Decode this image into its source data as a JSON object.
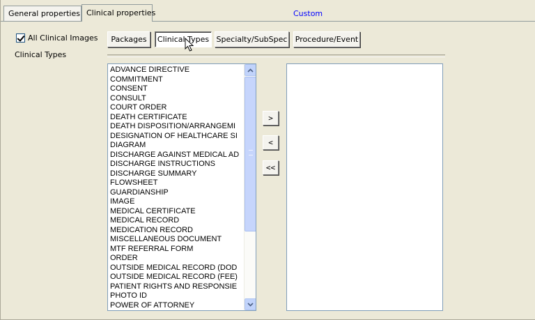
{
  "tabs": {
    "general": "General properties",
    "clinical": "Clinical properties",
    "custom": "Custom"
  },
  "left": {
    "checkbox_label": "All Clinical Images",
    "checkbox_checked": true,
    "types_label": "Clinical Types"
  },
  "buttons": {
    "packages": "Packages",
    "clinical_types": "Clinical Types",
    "specialty": "Specialty/SubSpec",
    "procedure": "Procedure/Event"
  },
  "list": {
    "items": [
      "ADVANCE DIRECTIVE",
      "COMMITMENT",
      "CONSENT",
      "CONSULT",
      "COURT ORDER",
      "DEATH CERTIFICATE",
      "DEATH DISPOSITION/ARRANGEMI",
      "DESIGNATION OF HEALTHCARE SI",
      "DIAGRAM",
      "DISCHARGE AGAINST MEDICAL AD",
      "DISCHARGE INSTRUCTIONS",
      "DISCHARGE SUMMARY",
      "FLOWSHEET",
      "GUARDIANSHIP",
      "IMAGE",
      "MEDICAL CERTIFICATE",
      "MEDICAL RECORD",
      "MEDICATION RECORD",
      "MISCELLANEOUS DOCUMENT",
      "MTF REFERRAL FORM",
      "ORDER",
      "OUTSIDE MEDICAL RECORD (DOD",
      "OUTSIDE MEDICAL RECORD (FEE)",
      "PATIENT RIGHTS AND RESPONSIE",
      "PHOTO ID",
      "POWER OF ATTORNEY"
    ]
  },
  "move_buttons": {
    "add": ">",
    "remove": "<",
    "remove_all": "<<"
  },
  "colors": {
    "custom_link": "#0000ff",
    "scroll_blue": "#c1d3fb"
  }
}
